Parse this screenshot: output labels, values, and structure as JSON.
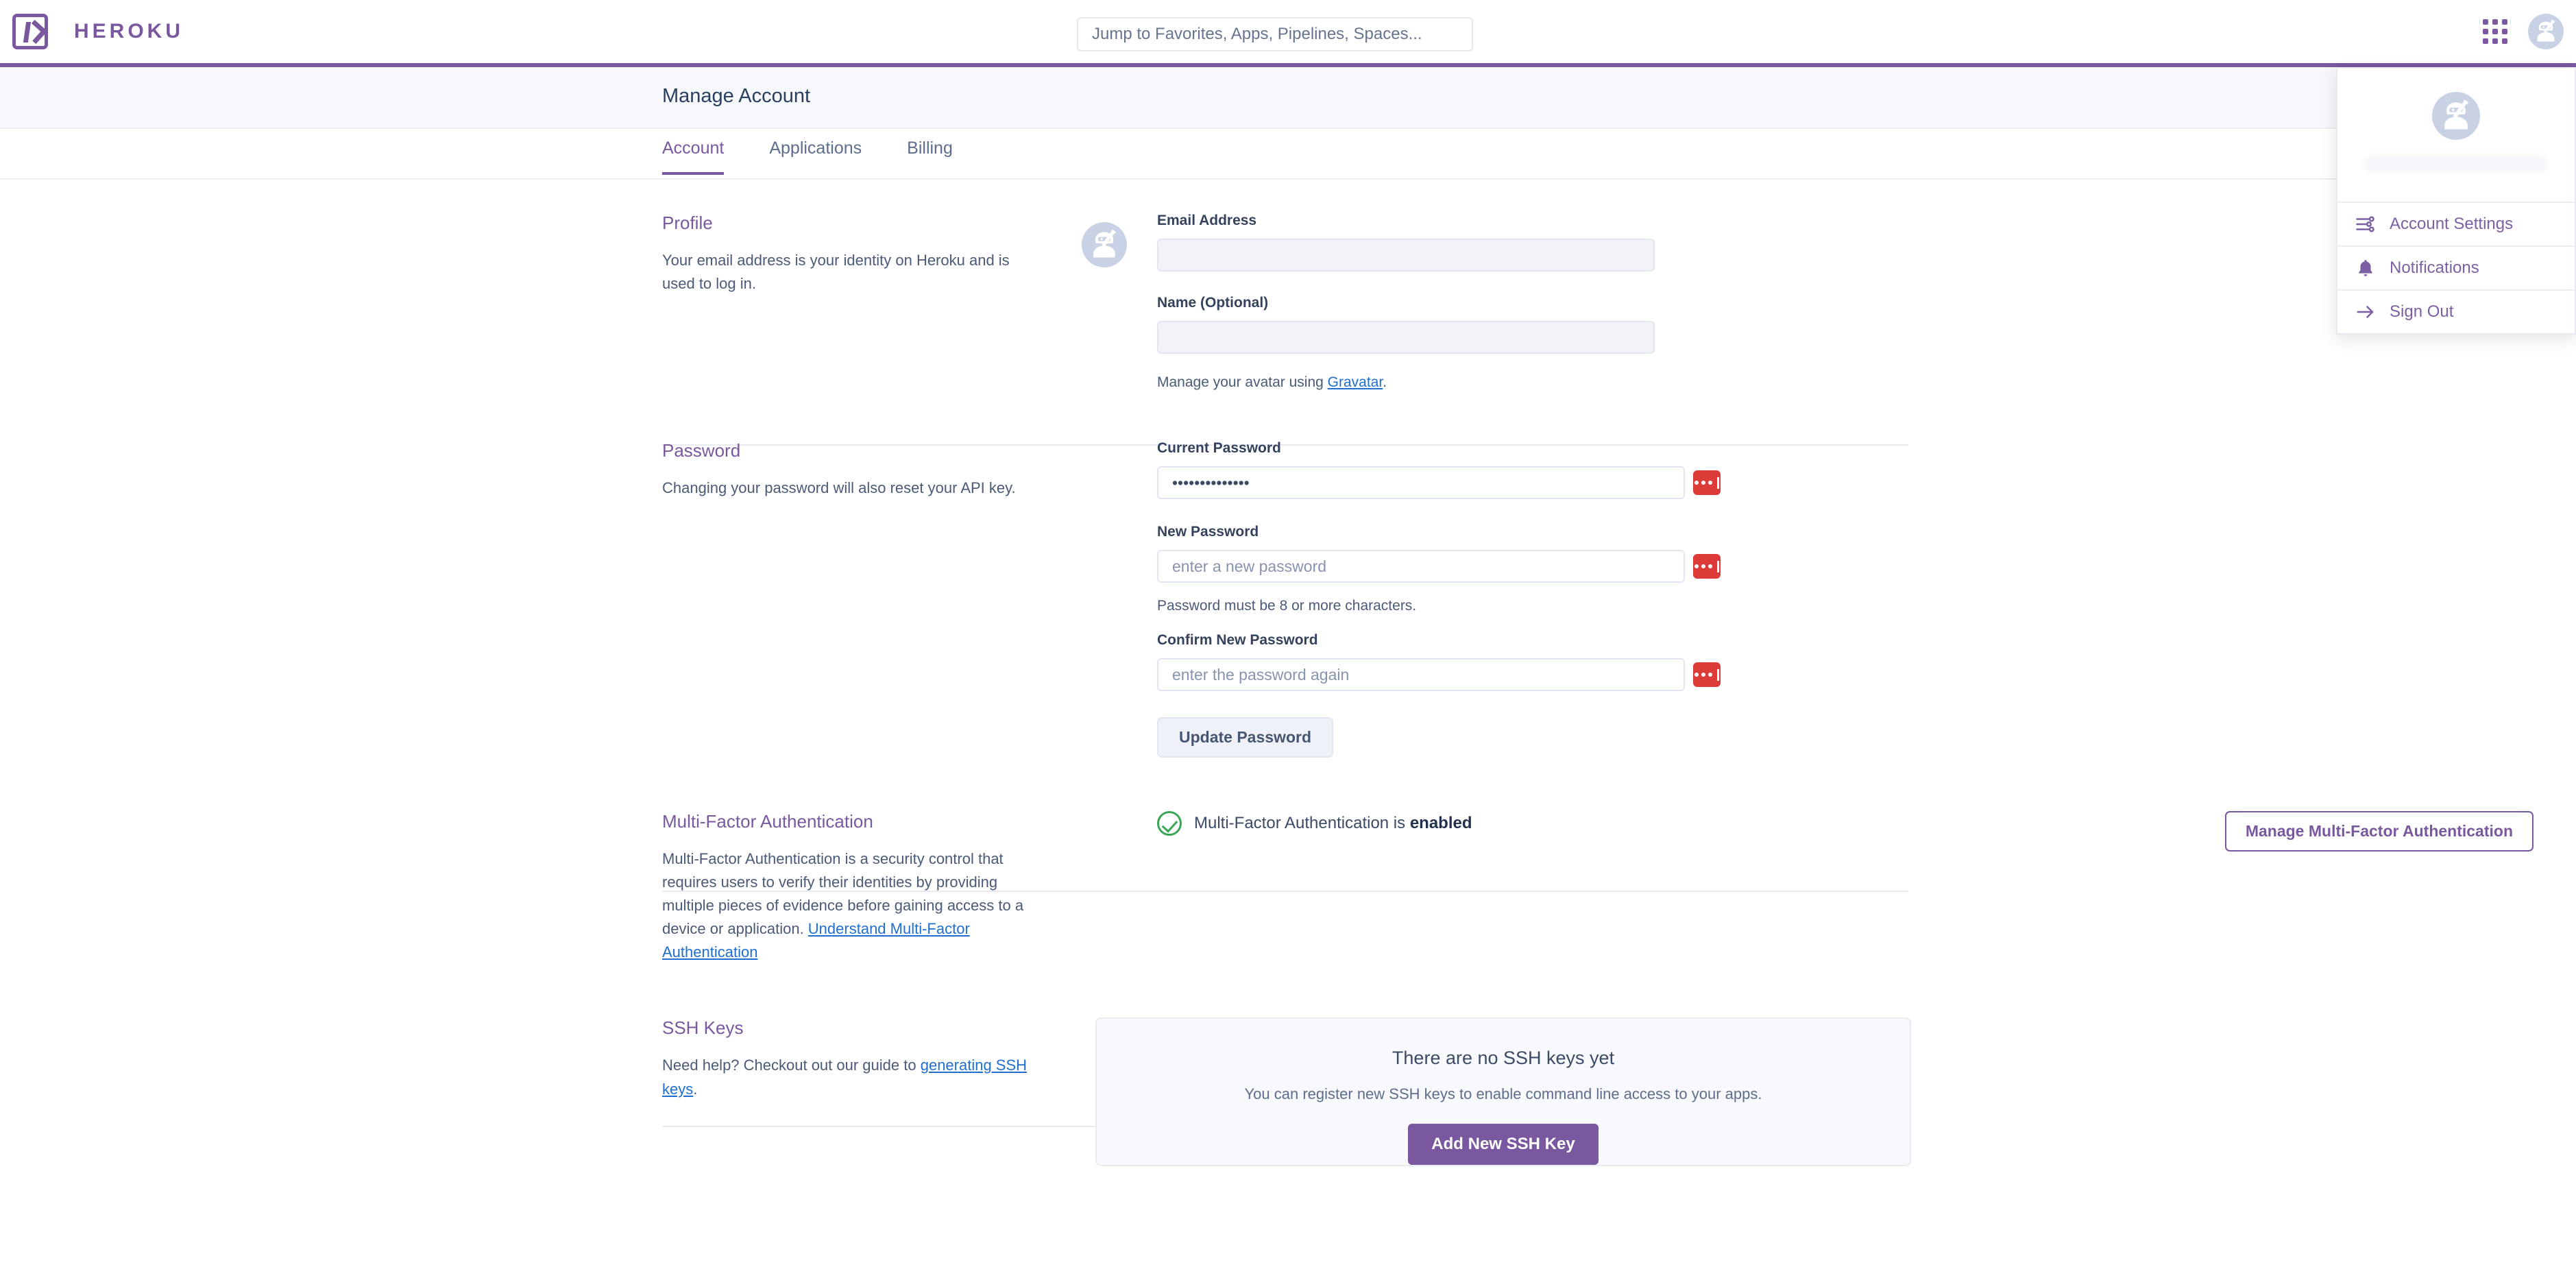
{
  "brand": {
    "wordmark": "HEROKU",
    "logo_icon": "heroku-logo-icon",
    "color": "#79589f"
  },
  "topbar": {
    "search": {
      "placeholder": "Jump to Favorites, Apps, Pipelines, Spaces...",
      "value": ""
    },
    "app_grid_icon": "app-grid-icon",
    "avatar_icon": "ninja-avatar-icon"
  },
  "header": {
    "title": "Manage Account"
  },
  "tabs": [
    {
      "label": "Account",
      "active": true
    },
    {
      "label": "Applications",
      "active": false
    },
    {
      "label": "Billing",
      "active": false
    }
  ],
  "profile": {
    "heading": "Profile",
    "description": "Your email address is your identity on Heroku and is used to log in.",
    "email_label": "Email Address",
    "email_value": "",
    "name_label": "Name (Optional)",
    "name_value": "",
    "gravatar_note_prefix": "Manage your avatar using ",
    "gravatar_link": "Gravatar",
    "gravatar_note_suffix": "."
  },
  "password": {
    "heading": "Password",
    "description": "Changing your password will also reset your API key.",
    "current_label": "Current Password",
    "current_value": "••••••••••••••",
    "new_label": "New Password",
    "new_placeholder": "enter a new password",
    "new_value": "",
    "rule_text": "Password must be 8 or more characters.",
    "confirm_label": "Confirm New Password",
    "confirm_placeholder": "enter the password again",
    "confirm_value": "",
    "update_button": "Update Password",
    "manager_badge_icon": "password-manager-icon",
    "manager_badge_color": "#dc3b37"
  },
  "mfa": {
    "heading": "Multi-Factor Authentication",
    "description_prefix": "Multi-Factor Authentication is a security control that requires users to verify their identities by providing multiple pieces of evidence before gaining access to a device or application. ",
    "description_link": "Understand Multi-Factor Authentication",
    "status_prefix": "Multi-Factor Authentication is ",
    "status_value": "enabled",
    "status_icon": "check-circle-icon",
    "status_color": "#3aa757",
    "manage_button": "Manage Multi-Factor Authentication"
  },
  "ssh": {
    "heading": "SSH Keys",
    "description_prefix": "Need help? Checkout out our guide to ",
    "description_link": "generating SSH keys",
    "description_suffix": ".",
    "empty_title": "There are no SSH keys yet",
    "empty_subtitle": "You can register new SSH keys to enable command line access to your apps.",
    "add_button": "Add New SSH Key"
  },
  "account_menu": {
    "avatar_icon": "ninja-avatar-icon",
    "username_redacted": "",
    "items": [
      {
        "label": "Account Settings",
        "icon": "sliders-icon"
      },
      {
        "label": "Notifications",
        "icon": "bell-icon"
      },
      {
        "label": "Sign Out",
        "icon": "arrow-right-icon"
      }
    ]
  }
}
